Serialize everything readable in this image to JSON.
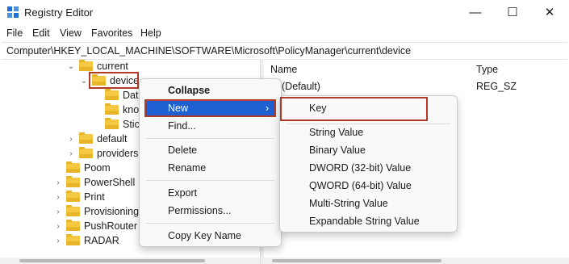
{
  "window": {
    "title": "Registry Editor",
    "controls": {
      "minimize": "—",
      "maximize": "☐",
      "close": "✕"
    }
  },
  "menubar": [
    "File",
    "Edit",
    "View",
    "Favorites",
    "Help"
  ],
  "address": "Computer\\HKEY_LOCAL_MACHINE\\SOFTWARE\\Microsoft\\PolicyManager\\current\\device",
  "tree": {
    "items": [
      {
        "label": "current",
        "expander": "⌄"
      },
      {
        "label": "device",
        "expander": "⌄"
      },
      {
        "label": "Data",
        "expander": ""
      },
      {
        "label": "kno",
        "expander": ""
      },
      {
        "label": "Stic",
        "expander": ""
      },
      {
        "label": "default",
        "expander": "›"
      },
      {
        "label": "providers",
        "expander": "›"
      },
      {
        "label": "Poom",
        "expander": ""
      },
      {
        "label": "PowerShell",
        "expander": "›"
      },
      {
        "label": "Print",
        "expander": "›"
      },
      {
        "label": "Provisioning",
        "expander": "›"
      },
      {
        "label": "PushRouter",
        "expander": "›"
      },
      {
        "label": "RADAR",
        "expander": "›"
      }
    ]
  },
  "list": {
    "columns": [
      "Name",
      "Type"
    ],
    "rows": [
      {
        "name": "(Default)",
        "type": "REG_SZ"
      }
    ]
  },
  "context_menu": {
    "items": [
      "Collapse",
      "New",
      "Find...",
      "Delete",
      "Rename",
      "Export",
      "Permissions...",
      "Copy Key Name"
    ],
    "submenu_arrow": "›"
  },
  "submenu": {
    "items": [
      "Key",
      "String Value",
      "Binary Value",
      "DWORD (32-bit) Value",
      "QWORD (64-bit) Value",
      "Multi-String Value",
      "Expandable String Value"
    ]
  },
  "colors": {
    "accent": "#1e5fd1",
    "highlight_box": "#b23a2a",
    "folder": "#f5c842"
  }
}
